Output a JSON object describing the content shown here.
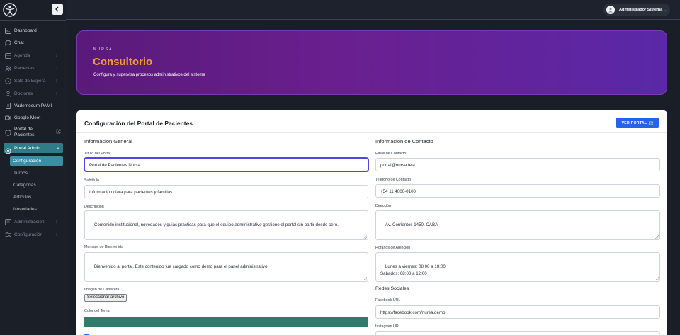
{
  "sidebar": {
    "items": [
      {
        "label": "Dashboard",
        "icon": "dashboard-icon"
      },
      {
        "label": "Chat",
        "icon": "chat-icon"
      },
      {
        "label": "Agenda",
        "icon": "calendar-icon",
        "chevron": "›"
      },
      {
        "label": "Pacientes",
        "icon": "users-icon",
        "chevron": "›"
      },
      {
        "label": "Sala de Espera",
        "icon": "clock-icon",
        "chevron": "›"
      },
      {
        "label": "Doctores",
        "icon": "doctor-icon",
        "chevron": "›"
      },
      {
        "label": "Vademécum PAMI",
        "icon": "book-icon"
      },
      {
        "label": "Google Meet",
        "icon": "video-icon"
      },
      {
        "label": "Portal de Pacientes",
        "icon": "portal-icon"
      },
      {
        "label": "Portal Admin",
        "icon": "gear-icon",
        "chevron": "⌄"
      },
      {
        "label": "Administración",
        "icon": "admin-icon",
        "chevron": "›"
      },
      {
        "label": "Configuración",
        "icon": "sliders-icon",
        "chevron": "›"
      }
    ],
    "portal_de_pacientes_line1": "Portal de",
    "portal_de_pacientes_line2": "Pacientes",
    "subitems": [
      "Configuración",
      "Turnos",
      "Categorías",
      "Artículos",
      "Novedades"
    ]
  },
  "topbar": {
    "user_name": "Administrador Sistema",
    "user_chevron": "⌄"
  },
  "hero": {
    "kicker": "NURSA",
    "title": "Consultorio",
    "subtitle": "Configura y supervisa procesos administrativos del sistema"
  },
  "card": {
    "title": "Configuración del Portal de Pacientes",
    "ver_portal_label": "VER PORTAL",
    "general": {
      "heading": "Información General",
      "titulo_label": "Título del Portal",
      "titulo_value": "Portal de Pacientes Nursa",
      "subtitulo_label": "Subtítulo",
      "subtitulo_value": "Informacion clara para pacientes y familias",
      "descripcion_label": "Descripción",
      "descripcion_value": "Contenido institucional, novedades y guias practicas para que el equipo administrativo gestione el portal sin partir desde cero.",
      "bienvenida_label": "Mensaje de Bienvenida",
      "bienvenida_value": "Bienvenido al portal. Este contenido fue cargado como demo para el panel administrativo.",
      "imagen_label": "Imagen de Cabecera",
      "imagen_button": "Seleccionar archivo",
      "color_label": "Color del Tema",
      "color_value": "#2f7b6e"
    },
    "contacto": {
      "heading": "Información de Contacto",
      "email_label": "Email de Contacto",
      "email_value": "portal@nursa.test",
      "telefono_label": "Teléfono de Contacto",
      "telefono_value": "+54 11 4000-0100",
      "direccion_label": "Dirección",
      "direccion_value": "Av. Corrientes 1450, CABA",
      "horarios_label": "Horarios de Atención",
      "horarios_value": "Lunes a viernes: 08:00 a 18:00\nSabados: 08:00 a 12:00",
      "redes_heading": "Redes Sociales",
      "facebook_label": "Facebook URL",
      "facebook_value": "https://facebook.com/nursa.demo",
      "instagram_label": "Instagram URL"
    }
  },
  "colors": {
    "accent": "#2563eb",
    "brand_orange": "#f39a3c",
    "sidebar_active": "#2f7b88",
    "hero_purple": "#6a1f8f"
  }
}
